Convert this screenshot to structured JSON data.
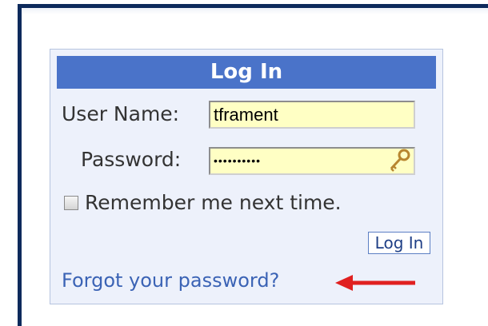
{
  "login": {
    "title": "Log In",
    "username_label": "User Name:",
    "username_value": "tframent",
    "password_label": "Password:",
    "password_value": "••••••••••",
    "remember_label": "Remember me next time.",
    "remember_checked": false,
    "submit_label": "Log In",
    "forgot_link": "Forgot your password?"
  },
  "icons": {
    "password_field": "key-icon",
    "annotation": "red-arrow-icon"
  },
  "colors": {
    "header": "#4a73c9",
    "panel": "#edf1fb",
    "input": "#ffffc4",
    "link": "#3b63b5",
    "frame": "#0d2a5c",
    "arrow": "#e02020"
  }
}
